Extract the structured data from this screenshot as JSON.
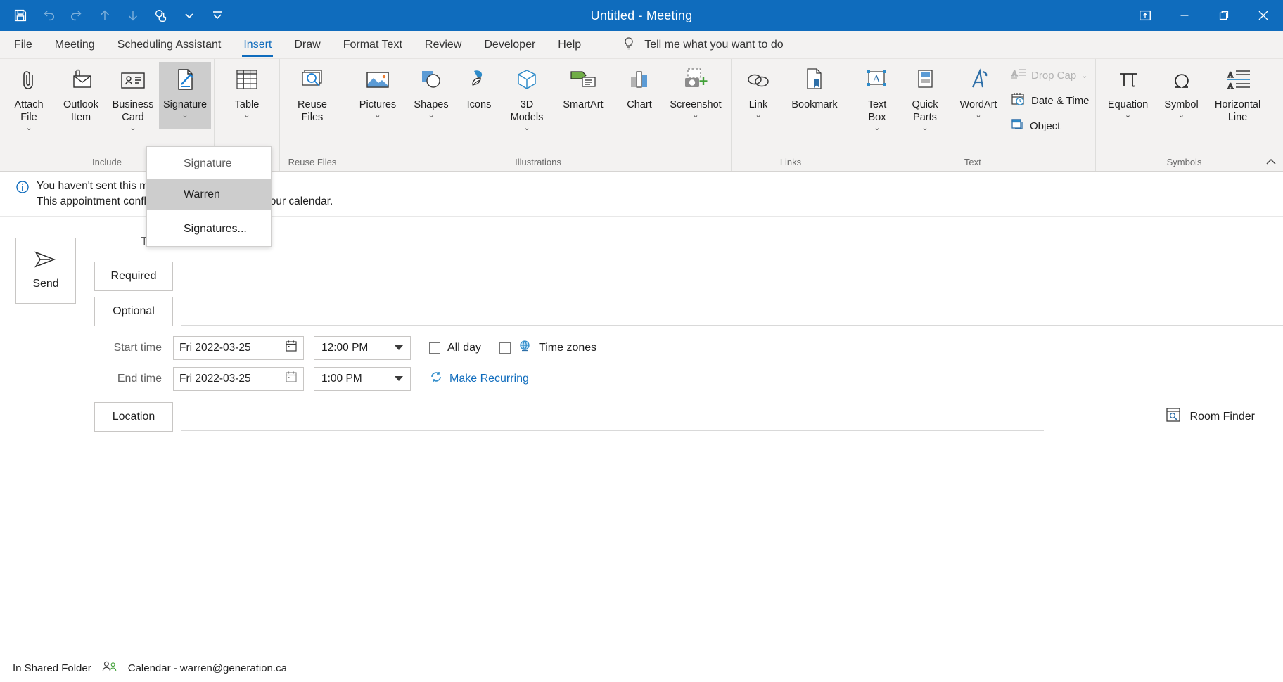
{
  "window": {
    "title": "Untitled  -  Meeting",
    "quick_access": [
      {
        "name": "save-icon",
        "label": "Save",
        "enabled": true
      },
      {
        "name": "undo-icon",
        "label": "Undo",
        "enabled": false
      },
      {
        "name": "redo-icon",
        "label": "Redo",
        "enabled": false
      },
      {
        "name": "previous-item-icon",
        "label": "Previous Item",
        "enabled": false
      },
      {
        "name": "next-item-icon",
        "label": "Next Item",
        "enabled": false
      },
      {
        "name": "touch-mode-icon",
        "label": "Touch/Mouse Mode",
        "enabled": true
      },
      {
        "name": "chevron-down-icon",
        "label": "Touch Mode Options",
        "enabled": true
      },
      {
        "name": "customize-quick-access-icon",
        "label": "Customize Quick Access Toolbar",
        "enabled": true
      }
    ],
    "controls": [
      {
        "name": "ribbon-display-options-button",
        "label": "Ribbon Display Options"
      },
      {
        "name": "minimize-button",
        "label": "Minimize"
      },
      {
        "name": "restore-button",
        "label": "Restore Down"
      },
      {
        "name": "close-button",
        "label": "Close"
      }
    ],
    "accent_color": "#0f6cbd"
  },
  "tabs": [
    {
      "label": "File",
      "active": false
    },
    {
      "label": "Meeting",
      "active": false
    },
    {
      "label": "Scheduling Assistant",
      "active": false
    },
    {
      "label": "Insert",
      "active": true
    },
    {
      "label": "Draw",
      "active": false
    },
    {
      "label": "Format Text",
      "active": false
    },
    {
      "label": "Review",
      "active": false
    },
    {
      "label": "Developer",
      "active": false
    },
    {
      "label": "Help",
      "active": false
    }
  ],
  "tell_me": {
    "label": "Tell me what you want to do",
    "icon": "lightbulb-icon"
  },
  "ribbon": {
    "groups": [
      {
        "label": "Include",
        "buttons": [
          {
            "label": "Attach\nFile",
            "icon": "paperclip-icon",
            "chevron": true,
            "selected": false
          },
          {
            "label": "Outlook\nItem",
            "icon": "envelope-attach-icon",
            "chevron": false,
            "selected": false
          },
          {
            "label": "Business\nCard",
            "icon": "business-card-icon",
            "chevron": true,
            "selected": false
          },
          {
            "label": "Signature",
            "icon": "signature-icon",
            "chevron": true,
            "selected": true
          }
        ]
      },
      {
        "label": "Tables",
        "buttons": [
          {
            "label": "Table",
            "icon": "table-icon",
            "chevron": true,
            "selected": false
          }
        ]
      },
      {
        "label": "Reuse Files",
        "buttons": [
          {
            "label": "Reuse\nFiles",
            "icon": "reuse-files-icon",
            "chevron": false,
            "selected": false
          }
        ]
      },
      {
        "label": "Illustrations",
        "buttons": [
          {
            "label": "Pictures",
            "icon": "pictures-icon",
            "chevron": true,
            "selected": false
          },
          {
            "label": "Shapes",
            "icon": "shapes-icon",
            "chevron": true,
            "selected": false
          },
          {
            "label": "Icons",
            "icon": "icons-icon",
            "chevron": false,
            "selected": false
          },
          {
            "label": "3D\nModels",
            "icon": "3d-models-icon",
            "chevron": true,
            "selected": false
          },
          {
            "label": "SmartArt",
            "icon": "smartart-icon",
            "chevron": false,
            "selected": false
          },
          {
            "label": "Chart",
            "icon": "chart-icon",
            "chevron": false,
            "selected": false
          },
          {
            "label": "Screenshot",
            "icon": "screenshot-icon",
            "chevron": true,
            "selected": false
          }
        ]
      },
      {
        "label": "Links",
        "buttons": [
          {
            "label": "Link",
            "icon": "link-icon",
            "chevron": true,
            "selected": false
          },
          {
            "label": "Bookmark",
            "icon": "bookmark-icon",
            "chevron": false,
            "selected": false
          }
        ]
      },
      {
        "label": "Text",
        "buttons": [
          {
            "label": "Text\nBox",
            "icon": "text-box-icon",
            "chevron": true,
            "selected": false
          },
          {
            "label": "Quick\nParts",
            "icon": "quick-parts-icon",
            "chevron": true,
            "selected": false
          },
          {
            "label": "WordArt",
            "icon": "wordart-icon",
            "chevron": true,
            "selected": false
          }
        ],
        "small_buttons": [
          {
            "label": "Drop Cap",
            "icon": "drop-cap-icon",
            "chevron": true,
            "disabled": true
          },
          {
            "label": "Date & Time",
            "icon": "date-time-icon",
            "chevron": false,
            "disabled": false
          },
          {
            "label": "Object",
            "icon": "object-icon",
            "chevron": false,
            "disabled": false
          }
        ]
      },
      {
        "label": "Symbols",
        "buttons": [
          {
            "label": "Equation",
            "icon": "equation-pi-icon",
            "chevron": true,
            "selected": false
          },
          {
            "label": "Symbol",
            "icon": "symbol-omega-icon",
            "chevron": true,
            "selected": false
          },
          {
            "label": "Horizontal\nLine",
            "icon": "horizontal-line-icon",
            "chevron": false,
            "selected": false
          }
        ]
      }
    ],
    "collapse_label": "Collapse the Ribbon"
  },
  "signature_menu": {
    "items": [
      {
        "label": "Signature",
        "type": "header",
        "highlighted": false
      },
      {
        "label": "Warren",
        "type": "item",
        "highlighted": true
      },
      {
        "label": "Signatures...",
        "type": "command",
        "highlighted": false
      }
    ]
  },
  "info_bar": {
    "icon": "info-icon",
    "line1": "You haven't sent this meeting invitation.",
    "line2": "This appointment conflicts with another one on your calendar."
  },
  "form": {
    "send_button": {
      "label": "Send",
      "icon": "send-arrow-icon"
    },
    "title_label": "Title",
    "title_value": "",
    "required_button": "Required",
    "required_value": "",
    "optional_button": "Optional",
    "optional_value": "",
    "start_time_label": "Start time",
    "start_date": "Fri 2022-03-25",
    "start_time": "12:00 PM",
    "end_time_label": "End time",
    "end_date": "Fri 2022-03-25",
    "end_time": "1:00 PM",
    "all_day_label": "All day",
    "all_day_checked": false,
    "time_zones_label": "Time zones",
    "time_zones_checked": false,
    "make_recurring_label": "Make Recurring",
    "location_button": "Location",
    "location_value": "",
    "room_finder_label": "Room Finder",
    "body_value": ""
  },
  "status_bar": {
    "folder_text": "In Shared Folder",
    "calendar_text": "Calendar - warren@generation.ca",
    "calendar_icon": "people-calendar-icon"
  }
}
